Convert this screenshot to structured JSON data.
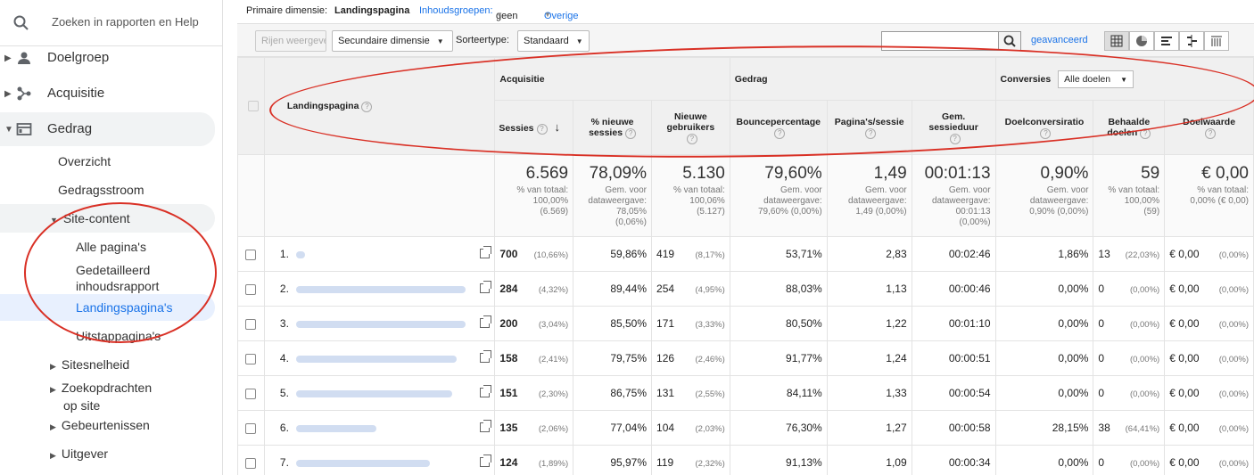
{
  "sidebar": {
    "search_placeholder": "Zoeken in rapporten en Help",
    "nav": [
      {
        "label": "Doelgroep"
      },
      {
        "label": "Acquisitie"
      },
      {
        "label": "Gedrag"
      }
    ],
    "gedrag_sub": {
      "overzicht": "Overzicht",
      "gedragsstroom": "Gedragsstroom",
      "site_content": "Site-content",
      "alle_paginas": "Alle pagina's",
      "gedetailleerd_1": "Gedetailleerd",
      "gedetailleerd_2": "inhoudsrapport",
      "landingspaginas": "Landingspagina's",
      "uitstappaginas": "Uitstappagina's",
      "sitesnelheid": "Sitesnelheid",
      "zoek_1": "Zoekopdrachten",
      "zoek_2": "op site",
      "gebeurtenissen": "Gebeurtenissen",
      "uitgever": "Uitgever"
    },
    "active_color": "#1a73e8"
  },
  "topbar": {
    "primary_label": "Primaire dimensie:",
    "primary_value": "Landingspagina",
    "content_groups_label": "Inhoudsgroepen:",
    "content_groups_value": "geen",
    "other": "Overige"
  },
  "toolbar": {
    "plot_rows": "Rijen weergeven",
    "secondary_dimension": "Secundaire dimensie",
    "sort_label": "Sorteertype:",
    "sort_value": "Standaard",
    "advanced": "geavanceerd"
  },
  "table": {
    "groups": {
      "acquisitie": "Acquisitie",
      "gedrag": "Gedrag",
      "conversies": "Conversies",
      "conversies_select": "Alle doelen"
    },
    "headers": {
      "landingspagina": "Landingspagina",
      "sessies": "Sessies",
      "pct_nieuwe_sessies_1": "% nieuwe",
      "pct_nieuwe_sessies_2": "sessies",
      "nieuwe_gebruikers_1": "Nieuwe",
      "nieuwe_gebruikers_2": "gebruikers",
      "bouncepercentage": "Bouncepercentage",
      "paginas_sessie": "Pagina's/sessie",
      "sessieduur_1": "Gem.",
      "sessieduur_2": "sessieduur",
      "doelconversie": "Doelconversiratio",
      "behaalde_doelen_1": "Behaalde",
      "behaalde_doelen_2": "doelen",
      "doelwaarde": "Doelwaarde"
    },
    "totals": {
      "sessies": {
        "value": "6.569",
        "l1": "% van totaal:",
        "l2": "100,00%",
        "l3": "(6.569)"
      },
      "pct_nieuwe": {
        "value": "78,09%",
        "l1": "Gem. voor",
        "l2": "dataweergave:",
        "l3": "78,05%",
        "l4": "(0,06%)"
      },
      "nieuwe_gebruikers": {
        "value": "5.130",
        "l1": "% van totaal:",
        "l2": "100,06%",
        "l3": "(5.127)"
      },
      "bounce": {
        "value": "79,60%",
        "l1": "Gem. voor",
        "l2": "dataweergave:",
        "l3": "79,60% (0,00%)"
      },
      "paginas": {
        "value": "1,49",
        "l1": "Gem. voor",
        "l2": "dataweergave:",
        "l3": "1,49 (0,00%)"
      },
      "duur": {
        "value": "00:01:13",
        "l1": "Gem. voor",
        "l2": "dataweergave:",
        "l3": "00:01:13",
        "l4": "(0,00%)"
      },
      "doelconversie": {
        "value": "0,90%",
        "l1": "Gem. voor",
        "l2": "dataweergave:",
        "l3": "0,90% (0,00%)"
      },
      "behaald": {
        "value": "59",
        "l1": "% van totaal:",
        "l2": "100,00%",
        "l3": "(59)"
      },
      "doelwaarde": {
        "value": "€ 0,00",
        "l1": "% van totaal:",
        "l2": "0,00% (€ 0,00)"
      }
    },
    "rows": [
      {
        "idx": "1.",
        "sessies": "700",
        "sessies_pct": "(10,66%)",
        "pct_nieuwe": "59,86%",
        "nieuwe": "419",
        "nieuwe_pct": "(8,17%)",
        "bounce": "53,71%",
        "paginas": "2,83",
        "duur": "00:02:46",
        "conv": "1,86%",
        "behaald": "13",
        "behaald_pct": "(22,03%)",
        "waarde": "€ 0,00",
        "waarde_pct": "(0,00%)"
      },
      {
        "idx": "2.",
        "sessies": "284",
        "sessies_pct": "(4,32%)",
        "pct_nieuwe": "89,44%",
        "nieuwe": "254",
        "nieuwe_pct": "(4,95%)",
        "bounce": "88,03%",
        "paginas": "1,13",
        "duur": "00:00:46",
        "conv": "0,00%",
        "behaald": "0",
        "behaald_pct": "(0,00%)",
        "waarde": "€ 0,00",
        "waarde_pct": "(0,00%)"
      },
      {
        "idx": "3.",
        "sessies": "200",
        "sessies_pct": "(3,04%)",
        "pct_nieuwe": "85,50%",
        "nieuwe": "171",
        "nieuwe_pct": "(3,33%)",
        "bounce": "80,50%",
        "paginas": "1,22",
        "duur": "00:01:10",
        "conv": "0,00%",
        "behaald": "0",
        "behaald_pct": "(0,00%)",
        "waarde": "€ 0,00",
        "waarde_pct": "(0,00%)"
      },
      {
        "idx": "4.",
        "sessies": "158",
        "sessies_pct": "(2,41%)",
        "pct_nieuwe": "79,75%",
        "nieuwe": "126",
        "nieuwe_pct": "(2,46%)",
        "bounce": "91,77%",
        "paginas": "1,24",
        "duur": "00:00:51",
        "conv": "0,00%",
        "behaald": "0",
        "behaald_pct": "(0,00%)",
        "waarde": "€ 0,00",
        "waarde_pct": "(0,00%)"
      },
      {
        "idx": "5.",
        "sessies": "151",
        "sessies_pct": "(2,30%)",
        "pct_nieuwe": "86,75%",
        "nieuwe": "131",
        "nieuwe_pct": "(2,55%)",
        "bounce": "84,11%",
        "paginas": "1,33",
        "duur": "00:00:54",
        "conv": "0,00%",
        "behaald": "0",
        "behaald_pct": "(0,00%)",
        "waarde": "€ 0,00",
        "waarde_pct": "(0,00%)"
      },
      {
        "idx": "6.",
        "sessies": "135",
        "sessies_pct": "(2,06%)",
        "pct_nieuwe": "77,04%",
        "nieuwe": "104",
        "nieuwe_pct": "(2,03%)",
        "bounce": "76,30%",
        "paginas": "1,27",
        "duur": "00:00:58",
        "conv": "28,15%",
        "behaald": "38",
        "behaald_pct": "(64,41%)",
        "waarde": "€ 0,00",
        "waarde_pct": "(0,00%)"
      },
      {
        "idx": "7.",
        "sessies": "124",
        "sessies_pct": "(1,89%)",
        "pct_nieuwe": "95,97%",
        "nieuwe": "119",
        "nieuwe_pct": "(2,32%)",
        "bounce": "91,13%",
        "paginas": "1,09",
        "duur": "00:00:34",
        "conv": "0,00%",
        "behaald": "0",
        "behaald_pct": "(0,00%)",
        "waarde": "€ 0,00",
        "waarde_pct": "(0,00%)"
      }
    ]
  }
}
